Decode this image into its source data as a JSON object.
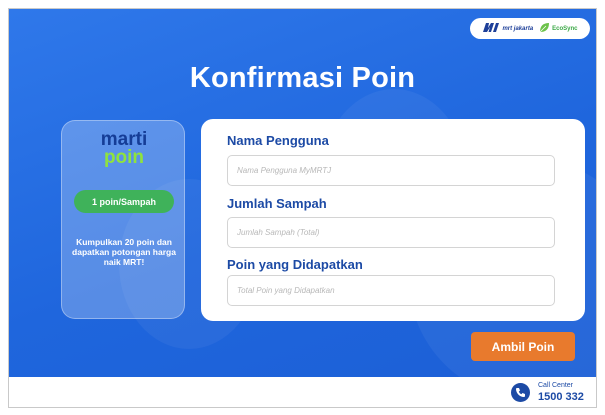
{
  "header": {
    "partner_mrt": "mrt jakarta",
    "partner_eco": "EcoSync",
    "title": "Konfirmasi Poin"
  },
  "promo": {
    "logo_line1": "marti",
    "logo_line2": "poin",
    "rate_badge": "1 poin/Sampah",
    "message": "Kumpulkan 20 poin dan dapatkan potongan harga naik MRT!"
  },
  "form": {
    "username": {
      "label": "Nama Pengguna",
      "placeholder": "Nama Pengguna MyMRTJ",
      "value": ""
    },
    "trash_count": {
      "label": "Jumlah Sampah",
      "placeholder": "Jumlah Sampah (Total)",
      "value": ""
    },
    "points_earned": {
      "label": "Poin yang Didapatkan",
      "placeholder": "Total Poin yang Didapatkan",
      "value": ""
    }
  },
  "actions": {
    "submit_label": "Ambil Poin"
  },
  "footer": {
    "call_label": "Call Center",
    "call_number": "1500 332"
  },
  "colors": {
    "background": "#2470e3",
    "title_text": "#ffffff",
    "label_text": "#1c4aa5",
    "badge": "#3fb25a",
    "button": "#e87a2d"
  },
  "icons": {
    "mrt": "mrt-logo-icon",
    "eco": "leaf-icon",
    "phone": "phone-icon"
  }
}
